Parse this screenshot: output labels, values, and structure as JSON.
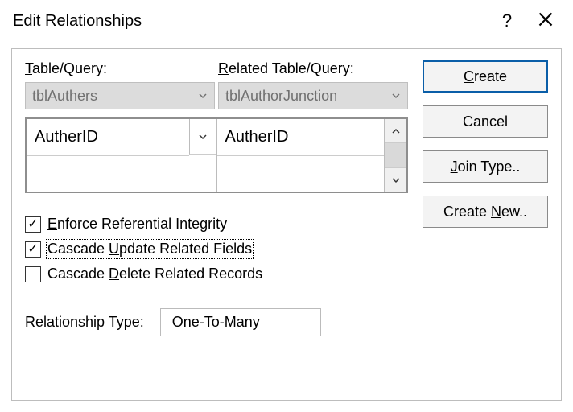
{
  "title": "Edit Relationships",
  "labels": {
    "table_query": "Table/Query:",
    "related_table_query": "Related Table/Query:",
    "relationship_type": "Relationship Type:"
  },
  "combos": {
    "primary": "tblAuthers",
    "related": "tblAuthorJunction"
  },
  "fields": {
    "primary": "AutherID",
    "related": "AutherID"
  },
  "checks": {
    "enforce": {
      "label": "Enforce Referential Integrity",
      "checked": true
    },
    "cascade_update": {
      "label": "Cascade Update Related Fields",
      "checked": true
    },
    "cascade_delete": {
      "label": "Cascade Delete Related Records",
      "checked": false
    }
  },
  "relationship_type_value": "One-To-Many",
  "buttons": {
    "create": "Create",
    "cancel": "Cancel",
    "join_type": "Join Type..",
    "create_new": "Create New.."
  }
}
